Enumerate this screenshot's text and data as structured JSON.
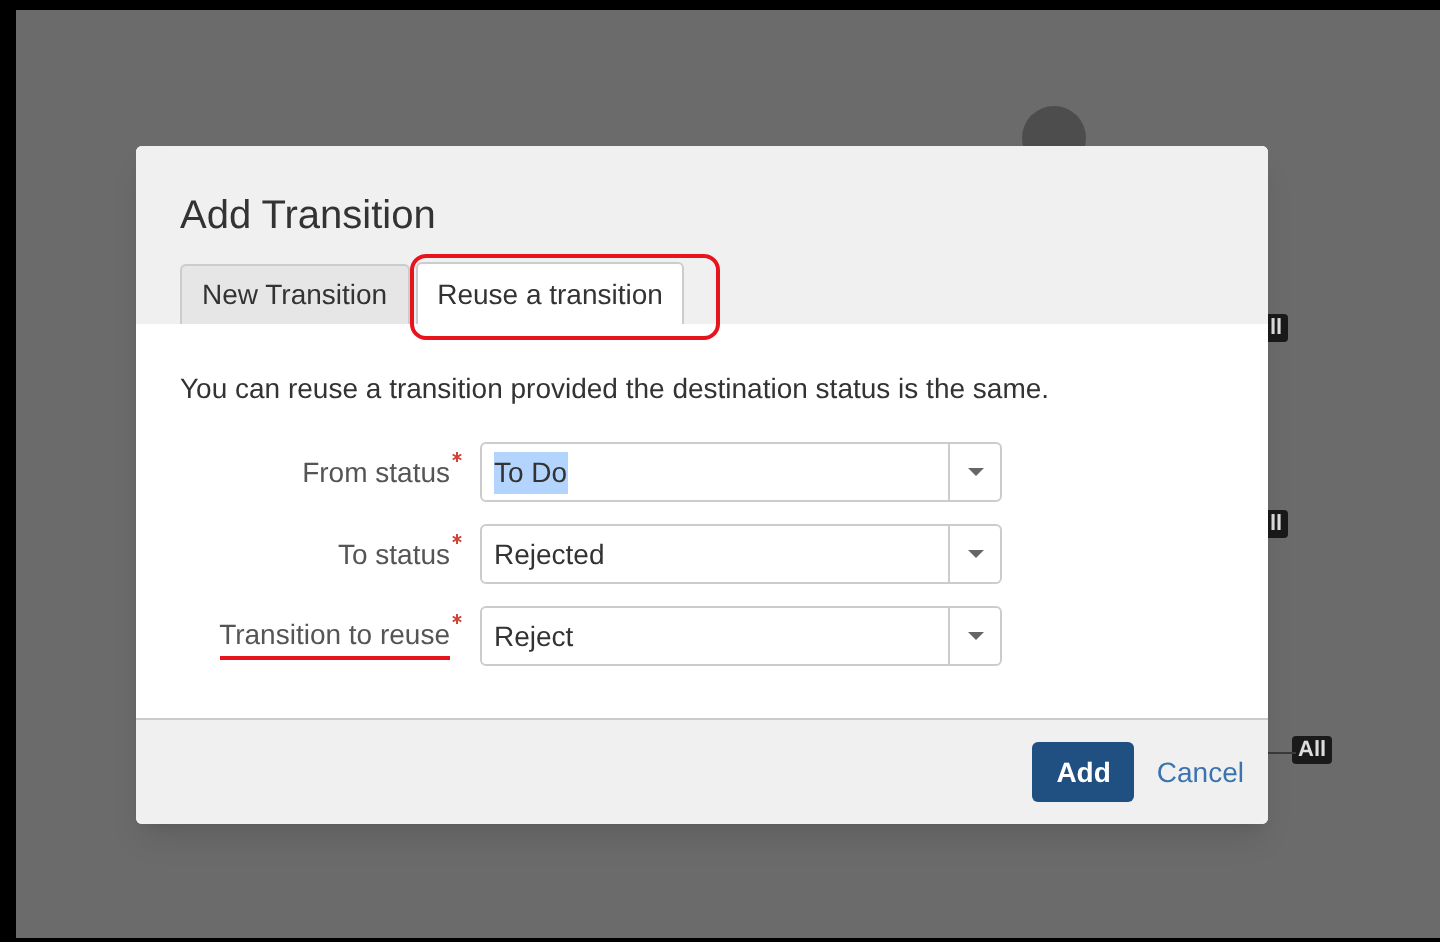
{
  "background": {
    "badges": [
      {
        "text": "ll"
      },
      {
        "text": "ll"
      },
      {
        "text": "All"
      }
    ]
  },
  "dialog": {
    "title": "Add Transition",
    "tabs": [
      {
        "label": "New Transition",
        "selected": false,
        "annotated": false
      },
      {
        "label": "Reuse a transition",
        "selected": true,
        "annotated": true
      }
    ],
    "description": "You can reuse a transition provided the destination status is the same.",
    "fields": [
      {
        "label": "From status",
        "required": true,
        "value": "To Do",
        "text_selected": true,
        "annotated": false
      },
      {
        "label": "To status",
        "required": true,
        "value": "Rejected",
        "text_selected": false,
        "annotated": false
      },
      {
        "label": "Transition to reuse",
        "required": true,
        "value": "Reject",
        "text_selected": false,
        "annotated": true
      }
    ],
    "buttons": [
      {
        "kind": "primary",
        "label": "Add"
      },
      {
        "kind": "link",
        "label": "Cancel"
      }
    ]
  }
}
